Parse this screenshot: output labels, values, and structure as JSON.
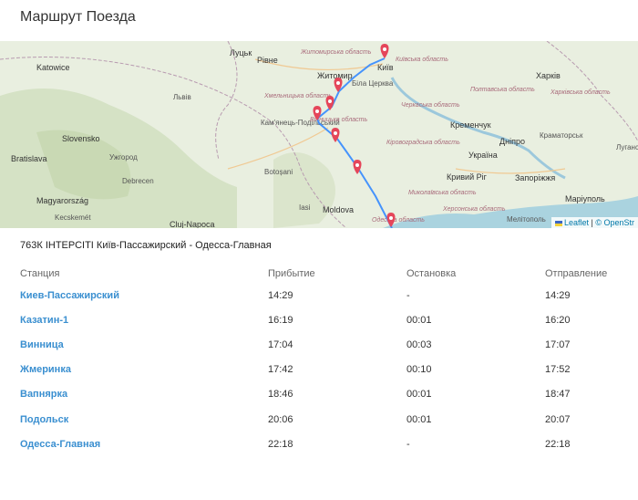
{
  "page": {
    "title": "Маршрут Поезда"
  },
  "map": {
    "attribution_leaflet": "Leaflet",
    "attribution_osm": "© OpenStr",
    "labels_big": [
      "Katowice",
      "Житомир",
      "Київ",
      "Луцьк",
      "Рівне",
      "Харків",
      "Slovensko",
      "Кременчук",
      "Україна",
      "Дніпро",
      "Bratislava",
      "Magyarország",
      "Moldova",
      "Кривий Ріг",
      "Запоріжжя",
      "Маріуполь",
      "Kecskemét",
      "Cluj-Napoca",
      "Iasi",
      "Мелітополь",
      "Львів",
      "Кам'янець-Подільський",
      "Debrecen",
      "Ужгород",
      "Botoșani",
      "Луганськ",
      "Біла Церква",
      "Краматорськ"
    ],
    "labels_region": [
      "Житомирська область",
      "Київська область",
      "Хмельницька область",
      "Вінницька область",
      "Черкаська область",
      "Кіровоградська область",
      "Миколаївська область",
      "Херсонська область",
      "Полтавська область",
      "Харківська область",
      "Одеська область"
    ]
  },
  "route": {
    "name": "763К ІНТЕРСІТІ Київ-Пассажирский - Одесса-Главная"
  },
  "table": {
    "headers": {
      "station": "Станция",
      "arrival": "Прибытие",
      "stop": "Остановка",
      "departure": "Отправление"
    },
    "rows": [
      {
        "station": "Киев-Пассажирский",
        "arrival": "14:29",
        "stop": "-",
        "departure": "14:29"
      },
      {
        "station": "Казатин-1",
        "arrival": "16:19",
        "stop": "00:01",
        "departure": "16:20"
      },
      {
        "station": "Винница",
        "arrival": "17:04",
        "stop": "00:03",
        "departure": "17:07"
      },
      {
        "station": "Жмеринка",
        "arrival": "17:42",
        "stop": "00:10",
        "departure": "17:52"
      },
      {
        "station": "Вапнярка",
        "arrival": "18:46",
        "stop": "00:01",
        "departure": "18:47"
      },
      {
        "station": "Подольск",
        "arrival": "20:06",
        "stop": "00:01",
        "departure": "20:07"
      },
      {
        "station": "Одесса-Главная",
        "arrival": "22:18",
        "stop": "-",
        "departure": "22:18"
      }
    ]
  }
}
